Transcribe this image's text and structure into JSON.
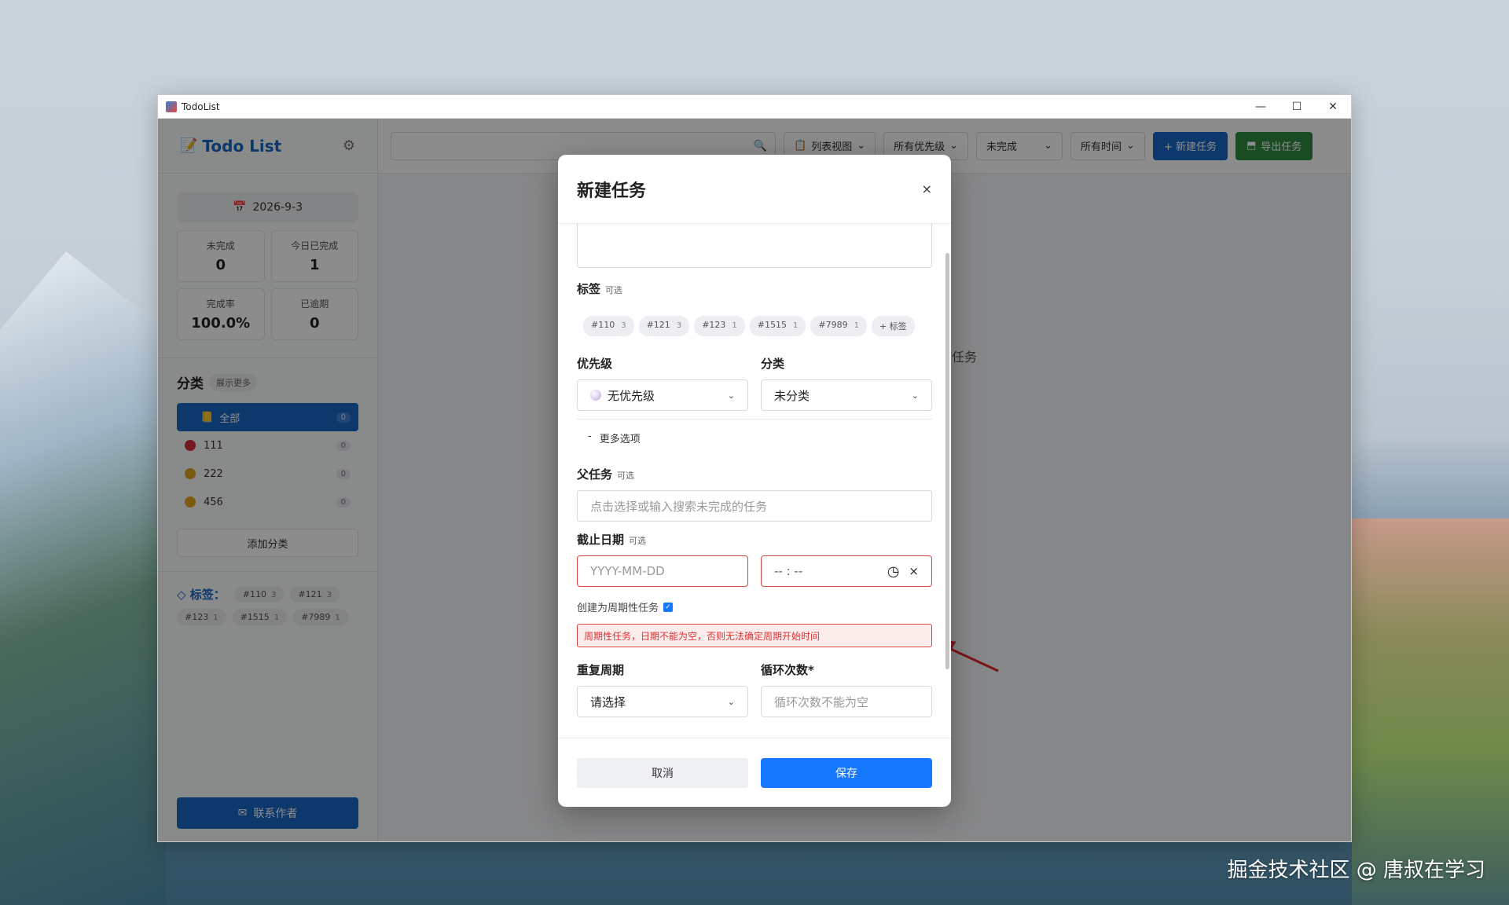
{
  "window": {
    "title": "TodoList",
    "controls": [
      "—",
      "☐",
      "✕"
    ]
  },
  "sidebar": {
    "logo": "Todo List",
    "date": "2026-9-3",
    "stats": [
      {
        "label": "未完成",
        "value": "0"
      },
      {
        "label": "今日已完成",
        "value": "1"
      },
      {
        "label": "完成率",
        "value": "100.0%"
      },
      {
        "label": "已逾期",
        "value": "0"
      }
    ],
    "categories_title": "分类",
    "categories_more": "展示更多",
    "categories": [
      {
        "name": "全部",
        "count": "0",
        "color": "#1666c5"
      },
      {
        "name": "111",
        "count": "0",
        "color": "#d0303a"
      },
      {
        "name": "222",
        "count": "0",
        "color": "#e0a31a"
      },
      {
        "name": "456",
        "count": "0",
        "color": "#e0a31a"
      }
    ],
    "add_category": "添加分类",
    "tags_title": "标签：",
    "tags": [
      {
        "name": "#110",
        "count": "3"
      },
      {
        "name": "#121",
        "count": "3"
      },
      {
        "name": "#123",
        "count": "1"
      },
      {
        "name": "#1515",
        "count": "1"
      },
      {
        "name": "#7989",
        "count": "1"
      }
    ],
    "contact": "联系作者"
  },
  "toolbar": {
    "view": "列表视图",
    "priority": "所有优先级",
    "status": "未完成",
    "time": "所有时间",
    "new_task": "+ 新建任务",
    "export": "导出任务"
  },
  "main": {
    "empty_text": "任务"
  },
  "modal": {
    "title": "新建任务",
    "close": "×",
    "tags_label": "标签",
    "tags_optional": "可选",
    "tags": [
      {
        "name": "#110",
        "count": "3"
      },
      {
        "name": "#121",
        "count": "3"
      },
      {
        "name": "#123",
        "count": "1"
      },
      {
        "name": "#1515",
        "count": "1"
      },
      {
        "name": "#7989",
        "count": "1"
      }
    ],
    "add_tag": "+ 标签",
    "priority_label": "优先级",
    "priority_value": "无优先级",
    "category_label": "分类",
    "category_value": "未分类",
    "more_options": "更多选项",
    "parent_label": "父任务",
    "parent_optional": "可选",
    "parent_placeholder": "点击选择或输入搜索未完成的任务",
    "due_label": "截止日期",
    "due_optional": "可选",
    "date_placeholder": "YYYY-MM-DD",
    "time_placeholder": "-- : --",
    "recurring_label": "创建为周期性任务",
    "recurring_error": "周期性任务，日期不能为空，否则无法确定周期开始时间",
    "repeat_label": "重复周期",
    "repeat_value": "请选择",
    "loop_label": "循环次数*",
    "loop_placeholder": "循环次数不能为空",
    "cancel": "取消",
    "save": "保存"
  },
  "watermark": "掘金技术社区 @ 唐叔在学习"
}
